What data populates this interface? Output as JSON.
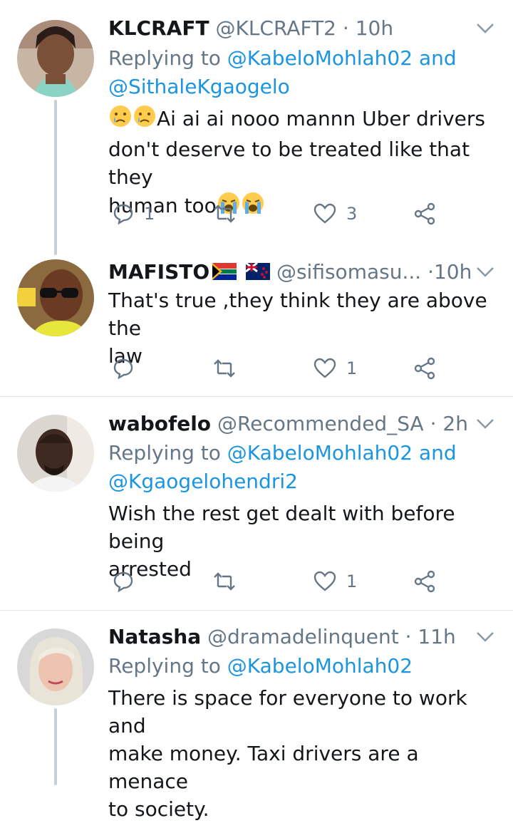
{
  "tweets": [
    {
      "name": "KLCRAFT",
      "handle": "@KLCRAFT2",
      "dot": "·",
      "time": "10h",
      "replying_prefix": "Replying to",
      "replying_to_1": "@KabeloMohlah02",
      "replying_and": "and",
      "replying_to_2": "@SithaleKgaogelo",
      "text_line1": "Ai ai ai nooo mannn Uber drivers",
      "text_line2": "don't deserve to be treated like that they",
      "text_line3": "human too",
      "reply_count": "1",
      "like_count": "3"
    },
    {
      "name": "MAFISTO",
      "handle": "@sifisomasu...",
      "dot": "·",
      "time": "10h",
      "text_line1": "That's true ,they think they are above the",
      "text_line2": "law",
      "like_count": "1"
    },
    {
      "name": "wabofelo",
      "handle": "@Recommended_SA",
      "dot": "·",
      "time": "2h",
      "replying_prefix": "Replying to",
      "replying_to_1": "@KabeloMohlah02",
      "replying_and": "and",
      "replying_to_2": "@Kgaogelohendri2",
      "text_line1": "Wish the rest get dealt with before being",
      "text_line2": "arrested",
      "like_count": "1"
    },
    {
      "name": "Natasha",
      "handle": "@dramadelinquent",
      "dot": "·",
      "time": "11h",
      "replying_prefix": "Replying to",
      "replying_to_1": "@KabeloMohlah02",
      "text_line1": "There is space for everyone to work and",
      "text_line2": "make money. Taxi drivers are a menace",
      "text_line3": "to society."
    }
  ],
  "colors": {
    "text": "#14171a",
    "secondary": "#657786",
    "link": "#1b95e0",
    "divider": "#dfe3e6",
    "thread_line": "#c4cfd6"
  }
}
